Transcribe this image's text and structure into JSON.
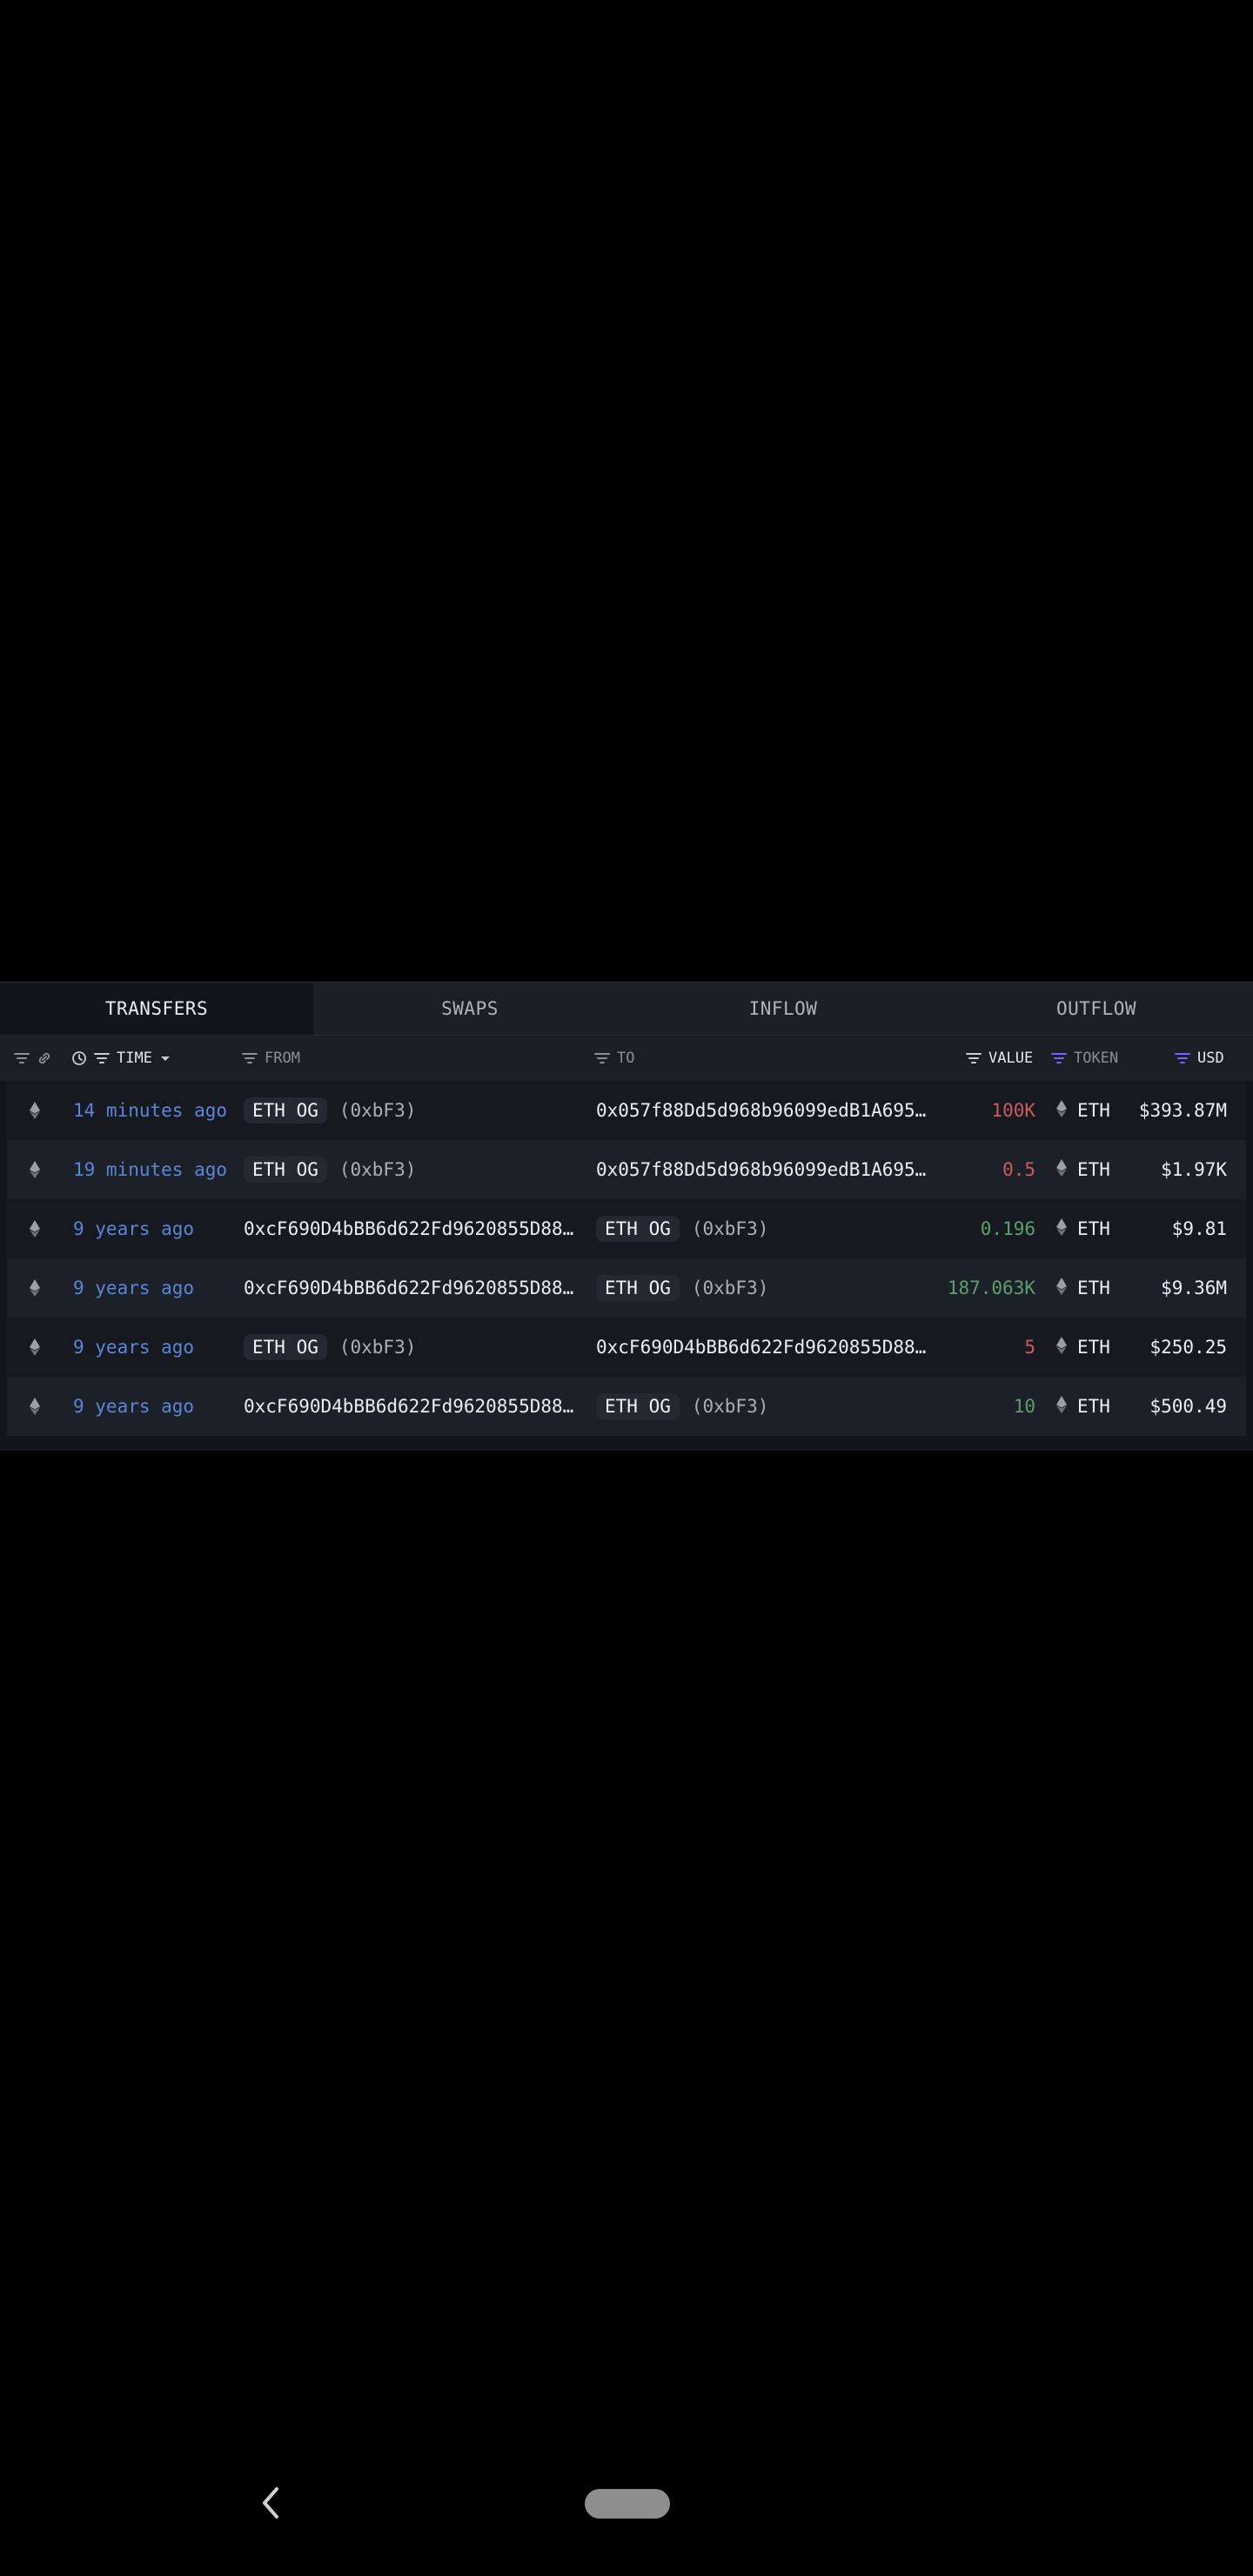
{
  "tabs": [
    "TRANSFERS",
    "SWAPS",
    "INFLOW",
    "OUTFLOW"
  ],
  "columns": {
    "time": "TIME",
    "from": "FROM",
    "to": "TO",
    "value": "VALUE",
    "token": "TOKEN",
    "usd": "USD"
  },
  "rows": [
    {
      "time": "14 minutes ago",
      "from_tag": "ETH OG",
      "from_short": "(0xbF3)",
      "from_addr": "",
      "to_tag": "",
      "to_short": "",
      "to_addr": "0x057f88Dd5d968b96099edB1A695…",
      "value": "100K",
      "value_color": "red",
      "token": "ETH",
      "usd": "$393.87M"
    },
    {
      "time": "19 minutes ago",
      "from_tag": "ETH OG",
      "from_short": "(0xbF3)",
      "from_addr": "",
      "to_tag": "",
      "to_short": "",
      "to_addr": "0x057f88Dd5d968b96099edB1A695…",
      "value": "0.5",
      "value_color": "red",
      "token": "ETH",
      "usd": "$1.97K"
    },
    {
      "time": "9 years ago",
      "from_tag": "",
      "from_short": "",
      "from_addr": "0xcF690D4bBB6d622Fd9620855D88…",
      "to_tag": "ETH OG",
      "to_short": "(0xbF3)",
      "to_addr": "",
      "value": "0.196",
      "value_color": "green",
      "token": "ETH",
      "usd": "$9.81"
    },
    {
      "time": "9 years ago",
      "from_tag": "",
      "from_short": "",
      "from_addr": "0xcF690D4bBB6d622Fd9620855D88…",
      "to_tag": "ETH OG",
      "to_short": "(0xbF3)",
      "to_addr": "",
      "value": "187.063K",
      "value_color": "green",
      "token": "ETH",
      "usd": "$9.36M"
    },
    {
      "time": "9 years ago",
      "from_tag": "ETH OG",
      "from_short": "(0xbF3)",
      "from_addr": "",
      "to_tag": "",
      "to_short": "",
      "to_addr": "0xcF690D4bBB6d622Fd9620855D88…",
      "value": "5",
      "value_color": "red",
      "token": "ETH",
      "usd": "$250.25"
    },
    {
      "time": "9 years ago",
      "from_tag": "",
      "from_short": "",
      "from_addr": "0xcF690D4bBB6d622Fd9620855D88…",
      "to_tag": "ETH OG",
      "to_short": "(0xbF3)",
      "to_addr": "",
      "value": "10",
      "value_color": "green",
      "token": "ETH",
      "usd": "$500.49"
    }
  ],
  "colors": {
    "red": "#cf5a5e",
    "green": "#5e9f6d",
    "time_link": "#5b86d8",
    "accent_filter": "#7b61ff"
  },
  "icons": {
    "filter": "filter-icon",
    "link": "link-icon",
    "clock": "clock-icon",
    "sort": "caret-down-icon",
    "eth": "eth-icon",
    "back": "back-chevron-icon",
    "home": "home-pill"
  }
}
